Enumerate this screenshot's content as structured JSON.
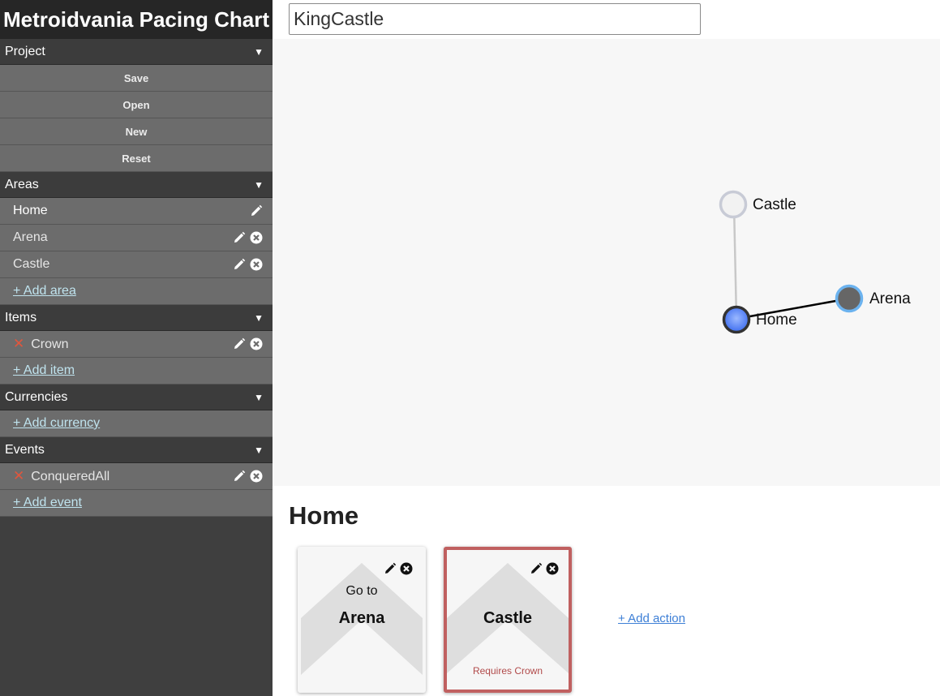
{
  "app": {
    "title": "Metroidvania Pacing Chart"
  },
  "project_name": "KingCastle",
  "sidebar": {
    "project": {
      "header": "Project",
      "buttons": [
        "Save",
        "Open",
        "New",
        "Reset"
      ]
    },
    "areas": {
      "header": "Areas",
      "items": [
        "Home",
        "Arena",
        "Castle"
      ],
      "add_label": "+ Add area"
    },
    "items": {
      "header": "Items",
      "items": [
        "Crown"
      ],
      "add_label": "+ Add item"
    },
    "currencies": {
      "header": "Currencies",
      "add_label": "+ Add currency"
    },
    "events": {
      "header": "Events",
      "items": [
        "ConqueredAll"
      ],
      "add_label": "+ Add event"
    },
    "collapse_glyph": "▼",
    "remove_glyph": "✕"
  },
  "graph": {
    "nodes": [
      {
        "label": "Castle",
        "color": "#f2f2f2",
        "ring": "#c8cbd6"
      },
      {
        "label": "Home",
        "color": "#5f8cff",
        "ring": "#333333"
      },
      {
        "label": "Arena",
        "color": "#666666",
        "ring": "#6cb3ef"
      }
    ]
  },
  "selected_area": {
    "title": "Home",
    "actions": [
      {
        "prefix": "Go to",
        "destination": "Arena",
        "requirement": ""
      },
      {
        "prefix": "",
        "destination": "Castle",
        "requirement": "Requires Crown"
      }
    ],
    "add_action_label": "+ Add action"
  },
  "colors": {
    "locked_border": "#c06060",
    "link": "#3d7fd6",
    "remove_x": "#e0563d"
  }
}
